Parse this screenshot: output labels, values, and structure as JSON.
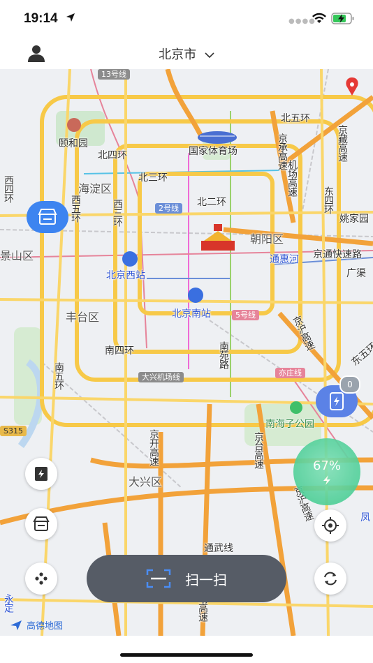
{
  "status_bar": {
    "time": "19:14",
    "battery_state": "charging",
    "icons": [
      "location-arrow-icon",
      "signal-dots-icon",
      "wifi-icon",
      "battery-charging-icon"
    ]
  },
  "header": {
    "city": "北京市",
    "icons": [
      "user-avatar-icon",
      "chevron-down-icon"
    ]
  },
  "map": {
    "labels": {
      "line13": "13号线",
      "yiheyuan": "颐和园",
      "beisihuan": "北四环",
      "guojiatiyuchang": "国家体育场",
      "beiwuhuan": "北五环",
      "jingchenggaosu": "京承高速",
      "jingzanggaosu": "京藏高速",
      "haidianqu": "海淀区",
      "beisanhuan": "北三环",
      "xisihuan": "西四环",
      "xiwuhuan": "西五环",
      "xisanhuan": "西三环",
      "jichanggaosu": "机场高速",
      "dongsihuan": "东四环",
      "beierhuan": "北二环",
      "line2": "2号线",
      "chaoyangqu": "朝阳区",
      "jingshanqu": "景山区",
      "yaojiayuan": "姚家园",
      "tonghuihe": "通惠河",
      "jingtongkuaisulu": "京通快速路",
      "guangqu": "广渠",
      "beijingxizhan": "北京西站",
      "fengtaiqu": "丰台区",
      "beijingnanzhan": "北京南站",
      "line5": "5号线",
      "jinghugaosu": "京沪高速",
      "nansihuan": "南四环",
      "nanyuanlu": "南苑路",
      "dongwuhuan": "东五环",
      "nanwuhuan": "南五环",
      "daxingjichangxian": "大兴机场线",
      "yizhuangxian": "亦庄线",
      "nanhaizigongyuan": "南海子公园",
      "s315": "S315",
      "jingkaigaosu": "京开高速",
      "jingtaigaosu": "京台高速",
      "daxingqu": "大兴区",
      "jinghugaosu2": "京沪高速",
      "feng": "凤",
      "tongwuxian": "通武线",
      "yongding": "永定",
      "changgaosu": "场高速"
    },
    "charging_station_count": "0",
    "battery_level": "67%",
    "provider": "高德地图"
  },
  "actions": {
    "scan_label": "扫一扫"
  },
  "colors": {
    "primary_blue": "#3d84f0",
    "scan_button_bg": "#565c66",
    "battery_green": "#4fcf98",
    "road_yellow": "#f7c948",
    "road_orange": "#f2a23a"
  }
}
